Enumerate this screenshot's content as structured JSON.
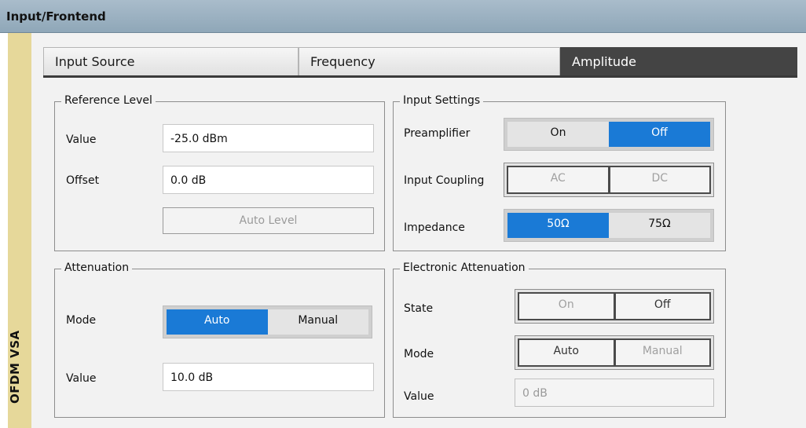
{
  "window": {
    "title": "Input/Frontend"
  },
  "sidebar": {
    "label": "OFDM VSA"
  },
  "tabs": [
    {
      "label": "Input Source"
    },
    {
      "label": "Frequency"
    },
    {
      "label": "Amplitude"
    }
  ],
  "reference_level": {
    "title": "Reference Level",
    "value_label": "Value",
    "value": "-25.0 dBm",
    "offset_label": "Offset",
    "offset": "0.0 dB",
    "auto_level_label": "Auto Level"
  },
  "input_settings": {
    "title": "Input Settings",
    "preamplifier_label": "Preamplifier",
    "preamplifier_options": [
      "On",
      "Off"
    ],
    "preamplifier_selected": "Off",
    "coupling_label": "Input Coupling",
    "coupling_options": [
      "AC",
      "DC"
    ],
    "impedance_label": "Impedance",
    "impedance_options": [
      "50Ω",
      "75Ω"
    ],
    "impedance_selected": "50Ω"
  },
  "attenuation": {
    "title": "Attenuation",
    "mode_label": "Mode",
    "mode_options": [
      "Auto",
      "Manual"
    ],
    "mode_selected": "Auto",
    "value_label": "Value",
    "value": "10.0 dB"
  },
  "electronic_attenuation": {
    "title": "Electronic Attenuation",
    "state_label": "State",
    "state_options": [
      "On",
      "Off"
    ],
    "mode_label": "Mode",
    "mode_options": [
      "Auto",
      "Manual"
    ],
    "value_label": "Value",
    "value": "0 dB"
  },
  "colors": {
    "accent": "#1a7ad6",
    "title_bar": "#9fb3c3",
    "sidebar": "#e6d89a",
    "active_tab": "#444444"
  }
}
